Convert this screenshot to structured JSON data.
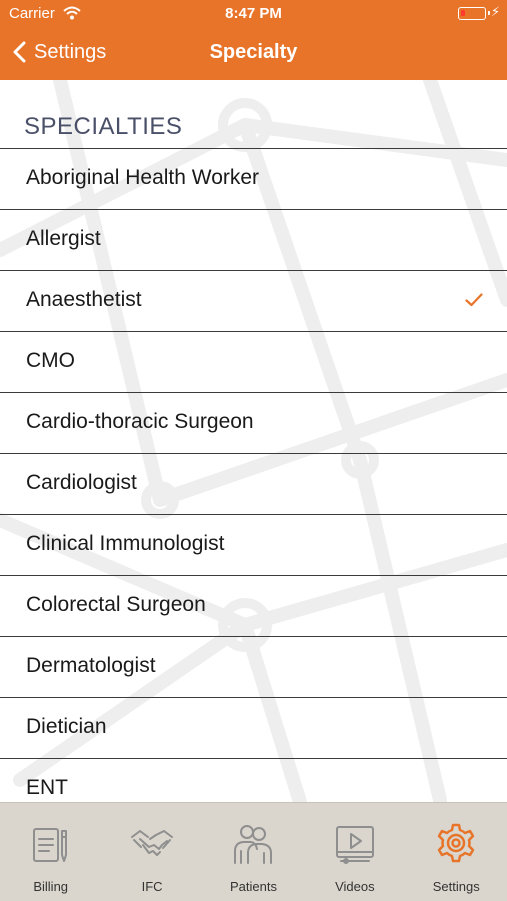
{
  "status_bar": {
    "carrier": "Carrier",
    "time": "8:47 PM",
    "battery_level": 0.2
  },
  "nav": {
    "back_label": "Settings",
    "title": "Specialty"
  },
  "section": {
    "title": "SPECIALTIES"
  },
  "specialties": [
    {
      "label": "Aboriginal Health Worker",
      "selected": false
    },
    {
      "label": "Allergist",
      "selected": false
    },
    {
      "label": "Anaesthetist",
      "selected": true
    },
    {
      "label": "CMO",
      "selected": false
    },
    {
      "label": "Cardio-thoracic Surgeon",
      "selected": false
    },
    {
      "label": "Cardiologist",
      "selected": false
    },
    {
      "label": "Clinical Immunologist",
      "selected": false
    },
    {
      "label": "Colorectal Surgeon",
      "selected": false
    },
    {
      "label": "Dermatologist",
      "selected": false
    },
    {
      "label": "Dietician",
      "selected": false
    },
    {
      "label": "ENT",
      "selected": false
    }
  ],
  "tabs": [
    {
      "label": "Billing",
      "icon": "billing-icon",
      "active": false
    },
    {
      "label": "IFC",
      "icon": "handshake-icon",
      "active": false
    },
    {
      "label": "Patients",
      "icon": "patients-icon",
      "active": false
    },
    {
      "label": "Videos",
      "icon": "video-icon",
      "active": false
    },
    {
      "label": "Settings",
      "icon": "gear-icon",
      "active": true
    }
  ],
  "colors": {
    "accent": "#e8742a",
    "tab_inactive": "#8f8f8f",
    "tabbar_bg": "#dad6cd",
    "section_header": "#4a5068"
  }
}
